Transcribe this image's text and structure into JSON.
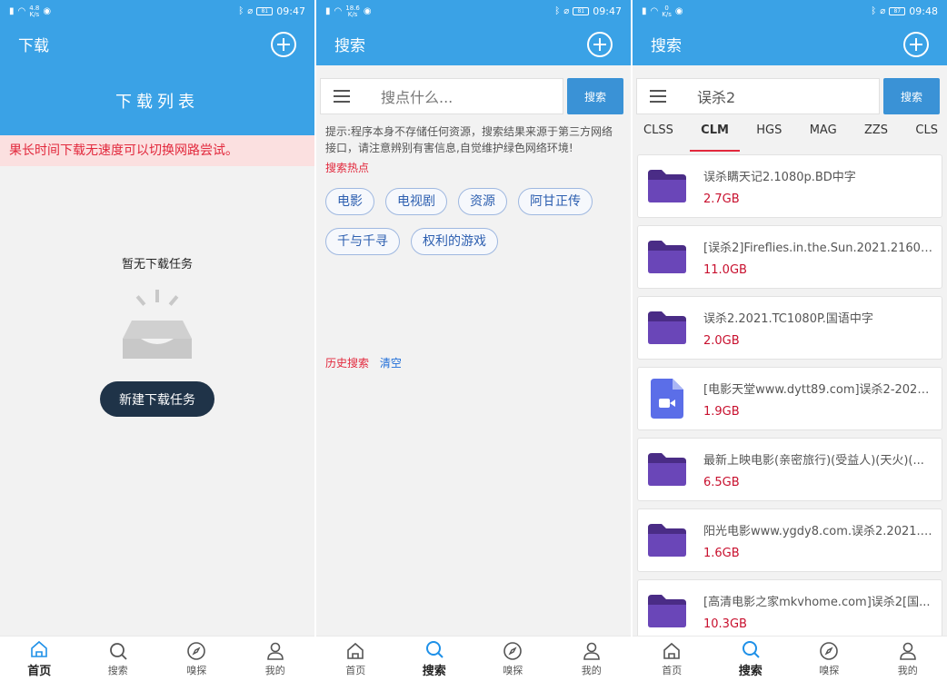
{
  "screen1": {
    "status": {
      "speed_top": "4.8",
      "speed_unit": "K/s",
      "battery": "81",
      "time": "09:47"
    },
    "title": "下载",
    "banner": "下载列表",
    "notice": "果长时间下载无速度可以切换网路尝试。",
    "empty_title": "暂无下载任务",
    "new_task_button": "新建下载任务"
  },
  "screen2": {
    "status": {
      "speed_top": "18.6",
      "speed_unit": "K/s",
      "battery": "81",
      "time": "09:47"
    },
    "title": "搜索",
    "search_placeholder": "搜点什么...",
    "search_button": "搜索",
    "hint": "提示:程序本身不存储任何资源，搜索结果来源于第三方网络接口，请注意辨别有害信息,自觉维护绿色网络环境!",
    "hot_title": "搜索热点",
    "hot_tags": [
      "电影",
      "电视剧",
      "资源",
      "阿甘正传",
      "千与千寻",
      "权利的游戏"
    ],
    "history_label": "历史搜索",
    "clear_label": "清空"
  },
  "screen3": {
    "status": {
      "speed_top": "0",
      "speed_unit": "K/s",
      "battery": "87",
      "time": "09:48"
    },
    "title": "搜索",
    "search_value": "误杀2",
    "search_button": "搜索",
    "tabs": [
      "CLSS",
      "CLM",
      "HGS",
      "MAG",
      "ZZS",
      "CLS"
    ],
    "active_tab": "CLM",
    "results": [
      {
        "name": "误杀瞒天记2.1080p.BD中字",
        "size": "2.7GB",
        "icon": "folder-icon"
      },
      {
        "name": "[误杀2]Fireflies.in.the.Sun.2021.2160p....",
        "size": "11.0GB",
        "icon": "folder-icon"
      },
      {
        "name": "误杀2.2021.TC1080P.国语中字",
        "size": "2.0GB",
        "icon": "folder-icon"
      },
      {
        "name": "[电影天堂www.dytt89.com]误杀2-2021...",
        "size": "1.9GB",
        "icon": "video-file-icon"
      },
      {
        "name": "最新上映电影(亲密旅行)(受益人)(天火)(...",
        "size": "6.5GB",
        "icon": "folder-icon"
      },
      {
        "name": "阳光电影www.ygdy8.com.误杀2.2021.H...",
        "size": "1.6GB",
        "icon": "folder-icon"
      },
      {
        "name": "[高清电影之家mkvhome.com]误杀2[国...",
        "size": "10.3GB",
        "icon": "folder-icon"
      }
    ]
  },
  "nav": [
    "首页",
    "搜索",
    "嗅探",
    "我的"
  ],
  "colors": {
    "primary": "#3aa2e6",
    "accent_red": "#e2283c",
    "folder": "#5e3a9e",
    "active_nav": "#1e90e8"
  }
}
